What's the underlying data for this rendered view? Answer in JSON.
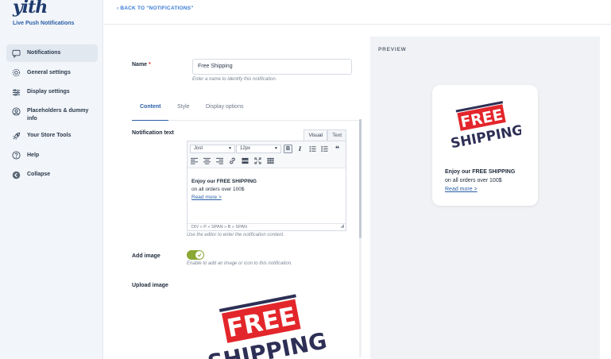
{
  "brand": {
    "logo_text": "yith",
    "plugin_name": "Live Push Notifications"
  },
  "sidebar": {
    "items": [
      {
        "label": "Notifications",
        "icon": "chat-bubble-icon",
        "active": true
      },
      {
        "label": "General settings",
        "icon": "gear-icon"
      },
      {
        "label": "Display settings",
        "icon": "sliders-icon"
      },
      {
        "label": "Placeholders & dummy info",
        "icon": "person-circle-icon"
      },
      {
        "label": "Your Store Tools",
        "icon": "rocket-icon"
      },
      {
        "label": "Help",
        "icon": "question-circle-icon"
      },
      {
        "label": "Collapse",
        "icon": "collapse-arrow-icon"
      }
    ]
  },
  "topbar": {
    "back_link": "‹ BACK TO \"NOTIFICATIONS\""
  },
  "form": {
    "name_label": "Name",
    "name_required_mark": "*",
    "name_value": "Free Shipping",
    "name_hint": "Enter a name to identify this notification.",
    "tabs": [
      {
        "label": "Content",
        "active": true
      },
      {
        "label": "Style"
      },
      {
        "label": "Display options"
      }
    ],
    "notification_text_label": "Notification text",
    "editor": {
      "mode_visual": "Visual",
      "mode_text": "Text",
      "font_family": "Jost",
      "font_size": "12px",
      "bold_btn": "B",
      "italic_btn": "I",
      "quote_btn": "❝",
      "content_bold": "Enjoy our FREE SHIPPING",
      "content_line2": "on all orders over 100$",
      "content_link": "Read more >",
      "status_path": "DIV » P » SPAN » B » SPAN"
    },
    "editor_hint": "Use the editor to enter the notification content.",
    "add_image_label": "Add image",
    "add_image_enabled": true,
    "add_image_hint": "Enable to add an image or icon to this notification.",
    "upload_image_label": "Upload image",
    "badge_text_line1": "FREE",
    "badge_text_line2": "SHIPPING"
  },
  "preview": {
    "title": "PREVIEW",
    "badge_line1": "FREE",
    "badge_line2": "SHIPPING",
    "text_bold": "Enjoy our FREE SHIPPING",
    "text_line2": "on all orders over 100$",
    "link": "Read more >"
  },
  "colors": {
    "accent": "#2a5fa8",
    "badge_red": "#e3262b",
    "badge_navy": "#2d2f55",
    "toggle_green": "#8aa833"
  }
}
